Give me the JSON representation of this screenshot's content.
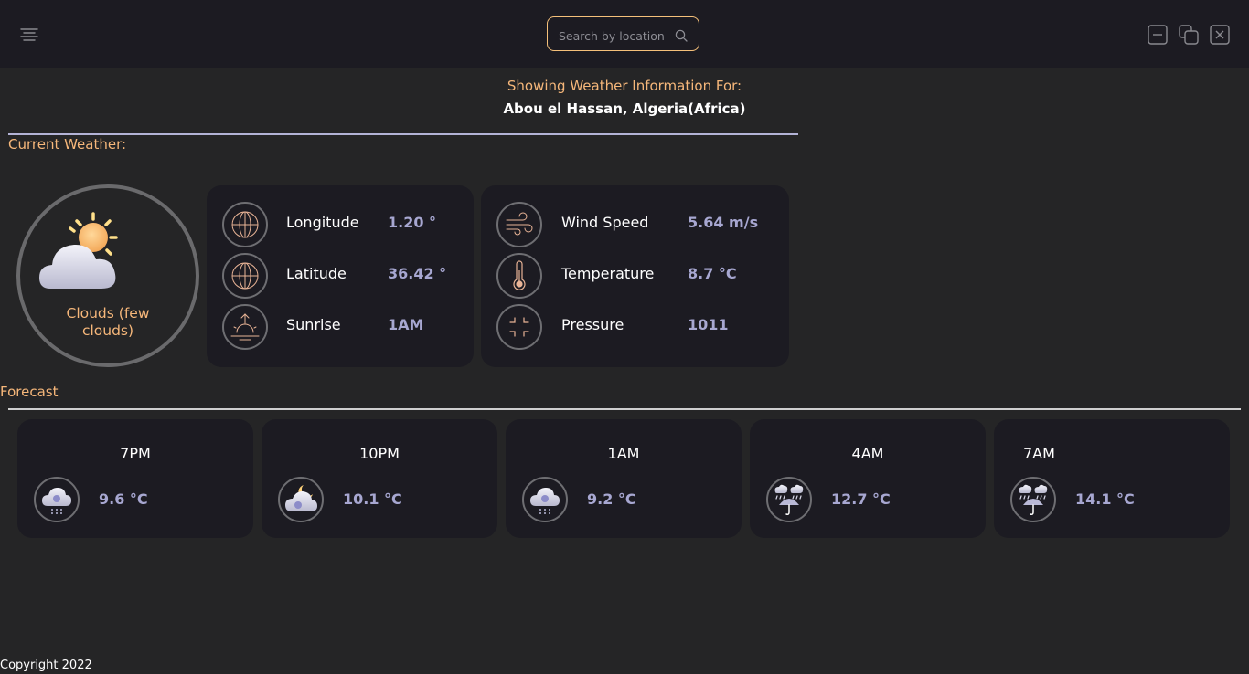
{
  "search": {
    "placeholder": "Search by location"
  },
  "header": {
    "subtitle": "Showing Weather Information For:",
    "location": "Abou el Hassan, Algeria(Africa)"
  },
  "current": {
    "section_label": "Current Weather:",
    "condition": "Clouds (few clouds)",
    "condition_icon": "sun-behind-cloud-icon",
    "left_card": [
      {
        "label": "Longitude",
        "value": "1.20 °",
        "icon": "globe-icon"
      },
      {
        "label": "Latitude",
        "value": "36.42 °",
        "icon": "globe-icon"
      },
      {
        "label": "Sunrise",
        "value": "1AM",
        "icon": "sunrise-icon"
      }
    ],
    "right_card": [
      {
        "label": "Wind Speed",
        "value": "5.64 m/s",
        "icon": "wind-icon"
      },
      {
        "label": "Temperature",
        "value": "8.7 °C",
        "icon": "thermometer-icon"
      },
      {
        "label": "Pressure",
        "value": "1011",
        "icon": "pressure-icon"
      }
    ]
  },
  "forecast": {
    "section_label": "Forecast",
    "items": [
      {
        "time": "7PM",
        "temp": "9.6 °C",
        "icon": "snow-cloud-icon"
      },
      {
        "time": "10PM",
        "temp": "10.1 °C",
        "icon": "cloud-night-icon"
      },
      {
        "time": "1AM",
        "temp": "9.2 °C",
        "icon": "snow-cloud-icon"
      },
      {
        "time": "4AM",
        "temp": "12.7 °C",
        "icon": "rain-umbrella-icon"
      },
      {
        "time": "7AM",
        "temp": "14.1 °C",
        "icon": "rain-umbrella-icon"
      }
    ]
  },
  "footer": {
    "copyright": "Copyright 2022"
  },
  "colors": {
    "accent": "#f6b77a",
    "value": "#a7a7d1",
    "card_bg": "#1c1b22",
    "page_bg": "#252526"
  }
}
